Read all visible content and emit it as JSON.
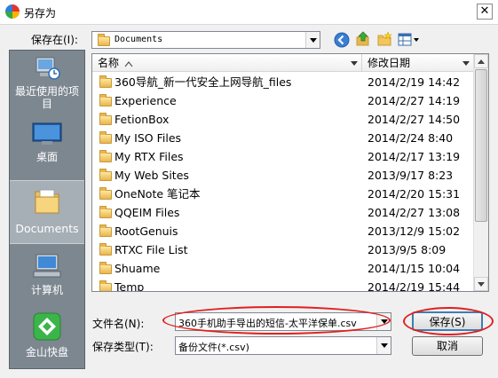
{
  "window": {
    "title": "另存为",
    "close_glyph": "✕"
  },
  "toolbar": {
    "save_in_label": "保存在(I):",
    "location": "Documents",
    "icons": [
      "back-icon",
      "up-folder-icon",
      "new-folder-icon",
      "views-menu-icon"
    ]
  },
  "places": [
    {
      "label": "最近使用的项目",
      "icon": "recent-items-icon",
      "selected": false
    },
    {
      "label": "桌面",
      "icon": "desktop-icon",
      "selected": false
    },
    {
      "label": "Documents",
      "icon": "documents-icon",
      "selected": true
    },
    {
      "label": "计算机",
      "icon": "computer-icon",
      "selected": false
    },
    {
      "label": "金山快盘",
      "icon": "kuaipan-icon",
      "selected": false
    }
  ],
  "filelist": {
    "columns": {
      "name": "名称",
      "modified": "修改日期"
    },
    "rows": [
      {
        "name": "360导航_新一代安全上网导航_files",
        "date": "2014/2/19 14:42"
      },
      {
        "name": "Experience",
        "date": "2014/2/27 14:19"
      },
      {
        "name": "FetionBox",
        "date": "2014/2/27 14:50"
      },
      {
        "name": "My ISO Files",
        "date": "2014/2/24 8:40"
      },
      {
        "name": "My RTX Files",
        "date": "2014/2/17 13:19"
      },
      {
        "name": "My Web Sites",
        "date": "2013/9/17 8:23"
      },
      {
        "name": "OneNote 笔记本",
        "date": "2014/2/20 15:31"
      },
      {
        "name": "QQEIM Files",
        "date": "2014/2/27 13:08"
      },
      {
        "name": "RootGenuis",
        "date": "2013/12/9 15:02"
      },
      {
        "name": "RTXC File List",
        "date": "2013/9/5 8:09"
      },
      {
        "name": "Shuame",
        "date": "2014/1/15 10:04"
      },
      {
        "name": "Temp",
        "date": "2014/2/19 15:44"
      }
    ]
  },
  "form": {
    "filename_label": "文件名(N):",
    "filename_value": "360手机助手导出的短信-太平洋保单.csv",
    "filetype_label": "保存类型(T):",
    "filetype_value": "备份文件(*.csv)",
    "save_label": "保存(S)",
    "cancel_label": "取消"
  },
  "colors": {
    "annotation": "#e02020",
    "places_bg": "#7d8790",
    "accent": "#3c7fb1"
  }
}
